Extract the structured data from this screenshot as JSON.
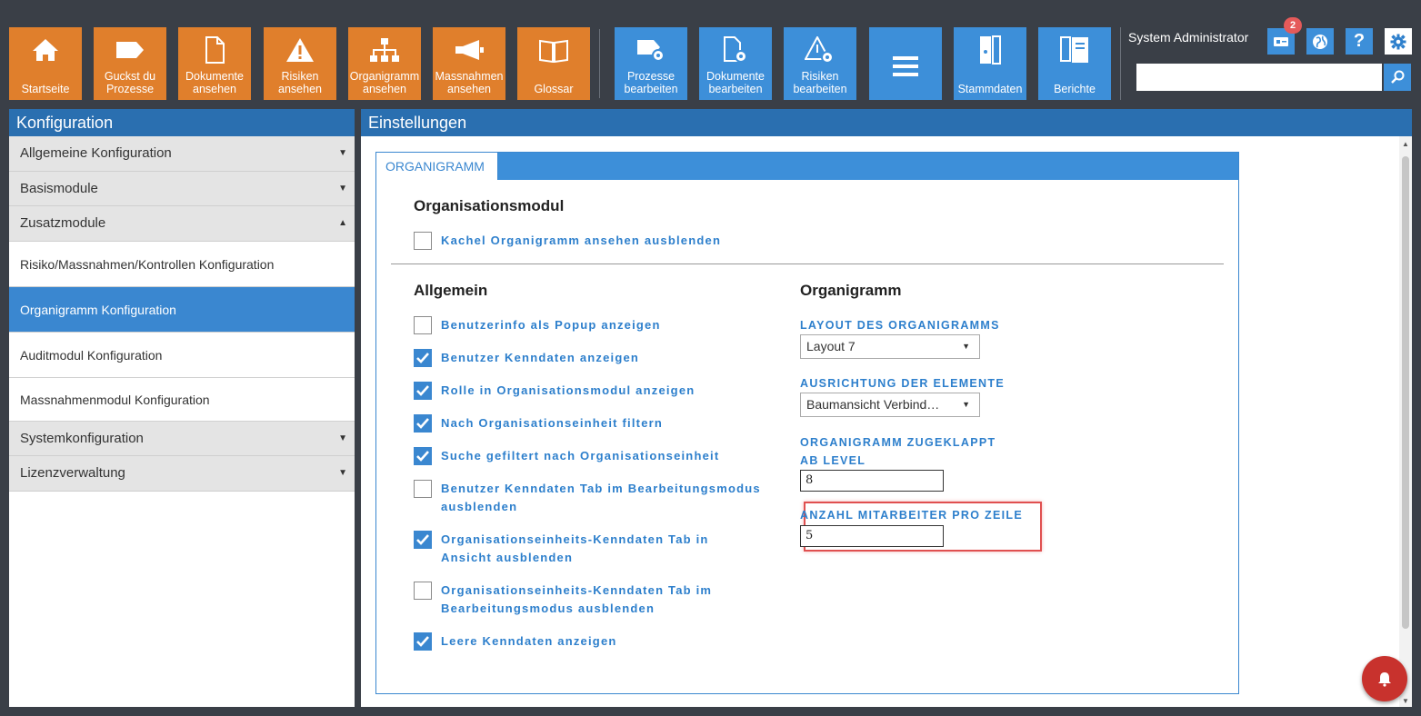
{
  "toolbar": {
    "tiles": [
      {
        "label": [
          "Startseite"
        ],
        "icon": "home-icon"
      },
      {
        "label": [
          "Guckst du",
          "Prozesse"
        ],
        "icon": "process-tag-icon"
      },
      {
        "label": [
          "Dokumente",
          "ansehen"
        ],
        "icon": "document-icon"
      },
      {
        "label": [
          "Risiken",
          "ansehen"
        ],
        "icon": "warning-icon"
      },
      {
        "label": [
          "Organigramm",
          "ansehen"
        ],
        "icon": "org-chart-icon"
      },
      {
        "label": [
          "Massnahmen",
          "ansehen"
        ],
        "icon": "megaphone-icon"
      },
      {
        "label": [
          "Glossar"
        ],
        "icon": "book-icon"
      },
      {
        "label": [
          "Prozesse",
          "bearbeiten"
        ],
        "icon": "process-gear-icon"
      },
      {
        "label": [
          "Dokumente",
          "bearbeiten"
        ],
        "icon": "document-gear-icon"
      },
      {
        "label": [
          "Risiken",
          "bearbeiten"
        ],
        "icon": "warning-gear-icon"
      },
      {
        "label": [],
        "icon": "hamburger-menu-icon"
      },
      {
        "label": [
          "Stammdaten"
        ],
        "icon": "binder-icon"
      },
      {
        "label": [
          "Berichte"
        ],
        "icon": "reports-icon"
      }
    ],
    "colors": {
      "orange": "#e07f2c",
      "blue": "#3d8fd9"
    }
  },
  "header": {
    "user_name": "System Administrator",
    "notification_count": "2",
    "help_label": "?",
    "search_value": ""
  },
  "left_panel": {
    "title": "Konfiguration",
    "groups_top": [
      {
        "label": "Allgemeine Konfiguration",
        "arrow": "▼"
      },
      {
        "label": "Basismodule",
        "arrow": "▼"
      },
      {
        "label": "Zusatzmodule",
        "arrow": "▲"
      }
    ],
    "sub_items": [
      {
        "label": "Risiko/Massnahmen/Kontrollen Konfiguration",
        "active": false
      },
      {
        "label": "Organigramm Konfiguration",
        "active": true
      },
      {
        "label": "Auditmodul Konfiguration",
        "active": false
      },
      {
        "label": "Massnahmenmodul Konfiguration",
        "active": false
      }
    ],
    "groups_bottom": [
      {
        "label": "Systemkonfiguration",
        "arrow": "▼"
      },
      {
        "label": "Lizenzverwaltung",
        "arrow": "▼"
      }
    ]
  },
  "main": {
    "title": "Einstellungen",
    "tab_label": "ORGANIGRAMM",
    "section_organisationsmodul": {
      "heading": "Organisationsmodul",
      "checkbox": {
        "label": "Kachel Organigramm ansehen ausblenden",
        "checked": false
      }
    },
    "section_allgemein": {
      "heading": "Allgemein",
      "checkboxes": [
        {
          "label": "Benutzerinfo als Popup anzeigen",
          "checked": false
        },
        {
          "label": "Benutzer Kenndaten anzeigen",
          "checked": true
        },
        {
          "label": "Rolle in Organisationsmodul anzeigen",
          "checked": true
        },
        {
          "label": "Nach Organisationseinheit filtern",
          "checked": true
        },
        {
          "label": "Suche gefiltert nach Organisationseinheit",
          "checked": true
        },
        {
          "label": "Benutzer Kenndaten Tab im Bearbeitungsmodus ausblenden",
          "checked": false
        },
        {
          "label": "Organisationseinheits-Kenndaten Tab in Ansicht ausblenden",
          "checked": true
        },
        {
          "label": "Organisationseinheits-Kenndaten Tab im Bearbeitungsmodus ausblenden",
          "checked": false
        },
        {
          "label": "Leere Kenndaten anzeigen",
          "checked": true
        }
      ]
    },
    "section_organigramm": {
      "heading": "Organigramm",
      "layout_label": "LAYOUT DES ORGANIGRAMMS",
      "layout_value": "Layout 7",
      "ausrichtung_label": "AUSRICHTUNG DER ELEMENTE",
      "ausrichtung_value": "Baumansicht Verbind…",
      "level_label": "ORGANIGRAMM ZUGEKLAPPT AB LEVEL",
      "level_value": "8",
      "mitarbeiter_label": "ANZAHL MITARBEITER PRO ZEILE",
      "mitarbeiter_value": "5"
    }
  }
}
